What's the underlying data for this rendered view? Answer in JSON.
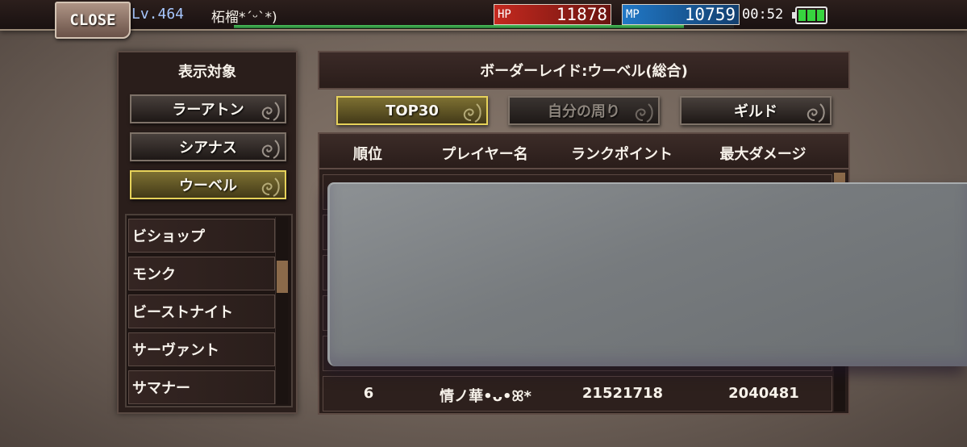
{
  "topbar": {
    "close_label": "CLOSE",
    "level": "Lv.464",
    "player_name": "柘榴*´ᵕ`*)",
    "exp_progress": 0.9,
    "hp_label": "HP",
    "hp_value": "11878",
    "mp_label": "MP",
    "mp_value": "10759",
    "time": "00:52",
    "battery_level": 1.0
  },
  "left_panel": {
    "title": "表示対象",
    "targets": [
      {
        "label": "ラーアトン",
        "active": false
      },
      {
        "label": "シアナス",
        "active": false
      },
      {
        "label": "ウーベル",
        "active": true
      }
    ],
    "classes": [
      "ビショップ",
      "モンク",
      "ビーストナイト",
      "サーヴァント",
      "サマナー"
    ]
  },
  "raid": {
    "title": "ボーダーレイド:ウーベル(総合)",
    "tabs": [
      {
        "label": "TOP30",
        "active": true,
        "disabled": false
      },
      {
        "label": "自分の周り",
        "active": false,
        "disabled": true
      },
      {
        "label": "ギルド",
        "active": false,
        "disabled": false
      }
    ],
    "columns": [
      "順位",
      "プレイヤー名",
      "ランクポイント",
      "最大ダメージ"
    ],
    "visible_row": {
      "rank": "6",
      "player": "情ノ華•ᴗ•ꕤ*",
      "rank_points": "21521718",
      "max_damage": "2040481"
    }
  },
  "colors": {
    "active_border": "#e6d25a",
    "hp": "#c5291f",
    "mp": "#2178c6",
    "battery": "#37d53f",
    "exp": "#4cc05c"
  }
}
